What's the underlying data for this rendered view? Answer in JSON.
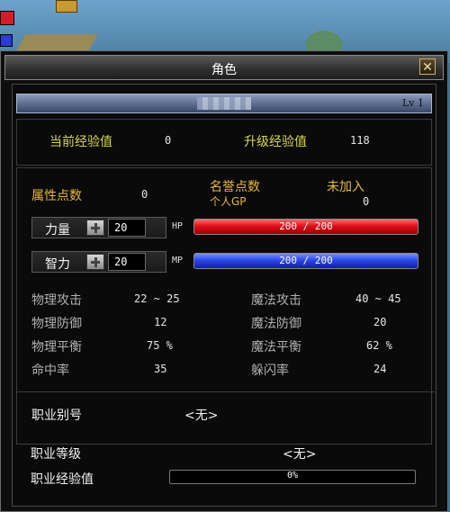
{
  "window": {
    "title": "角色",
    "level": "Lv 1"
  },
  "experience": {
    "current_label": "当前经验值",
    "current_value": "0",
    "upgrade_label": "升级经验值",
    "upgrade_value": "118"
  },
  "attributes": {
    "points_label": "属性点数",
    "points_value": "0",
    "honor_label": "名誉点数",
    "honor_value": "未加入",
    "gp_label": "个人GP",
    "gp_value": "0"
  },
  "strength": {
    "label": "力量",
    "value": "20",
    "bar_label": "HP",
    "bar_text": "200 / 200",
    "fill": 1.0
  },
  "intelligence": {
    "label": "智力",
    "value": "20",
    "bar_label": "MP",
    "bar_text": "200 / 200",
    "fill": 1.0
  },
  "combat": {
    "phys_attack_label": "物理攻击",
    "phys_attack_value": "22 ~ 25",
    "mag_attack_label": "魔法攻击",
    "mag_attack_value": "40 ~ 45",
    "phys_def_label": "物理防御",
    "phys_def_value": "12",
    "mag_def_label": "魔法防御",
    "mag_def_value": "20",
    "phys_bal_label": "物理平衡",
    "phys_bal_value": "75 %",
    "mag_bal_label": "魔法平衡",
    "mag_bal_value": "62 %",
    "hit_label": "命中率",
    "hit_value": "35",
    "dodge_label": "躲闪率",
    "dodge_value": "24"
  },
  "job": {
    "alias_label": "职业别号",
    "alias_value": "<无>",
    "level_label": "职业等级",
    "level_value": "<无>",
    "exp_label": "职业经验值",
    "exp_value": "0%",
    "exp_fill": 0
  },
  "colors": {
    "hp": "#e01018",
    "mp": "#2a48e8",
    "label_yellow": "#d6d84c",
    "label_orange": "#e8b83c"
  },
  "icons": {
    "close": "close-icon",
    "plus": "plus-icon"
  }
}
